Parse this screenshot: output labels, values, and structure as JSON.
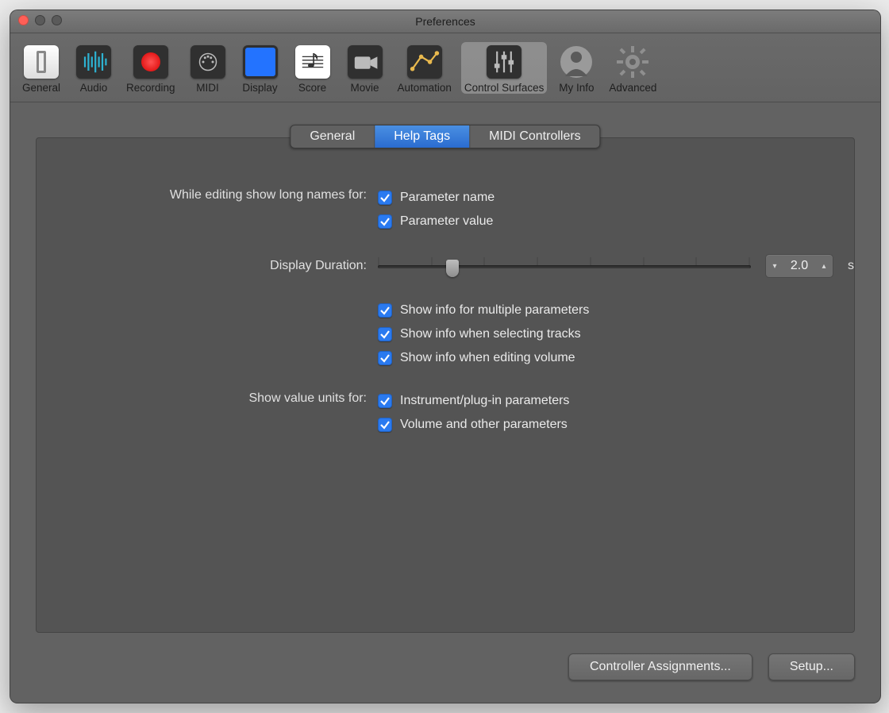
{
  "window_title": "Preferences",
  "toolbar": {
    "items": [
      {
        "id": "general",
        "label": "General"
      },
      {
        "id": "audio",
        "label": "Audio"
      },
      {
        "id": "recording",
        "label": "Recording"
      },
      {
        "id": "midi",
        "label": "MIDI"
      },
      {
        "id": "display",
        "label": "Display"
      },
      {
        "id": "score",
        "label": "Score"
      },
      {
        "id": "movie",
        "label": "Movie"
      },
      {
        "id": "automation",
        "label": "Automation"
      },
      {
        "id": "control-surfaces",
        "label": "Control Surfaces",
        "selected": true
      },
      {
        "id": "my-info",
        "label": "My Info"
      },
      {
        "id": "advanced",
        "label": "Advanced"
      }
    ]
  },
  "tabs": {
    "items": [
      {
        "label": "General"
      },
      {
        "label": "Help Tags",
        "active": true
      },
      {
        "label": "MIDI Controllers"
      }
    ]
  },
  "sections": {
    "long_names_label": "While editing show long names for:",
    "long_names": [
      {
        "label": "Parameter name",
        "checked": true
      },
      {
        "label": "Parameter value",
        "checked": true
      }
    ],
    "display_duration_label": "Display Duration:",
    "display_duration_value": "2.0",
    "display_duration_unit": "s",
    "extra_checks": [
      {
        "label": "Show info for multiple parameters",
        "checked": true
      },
      {
        "label": "Show info when selecting tracks",
        "checked": true
      },
      {
        "label": "Show info when editing volume",
        "checked": true
      }
    ],
    "value_units_label": "Show value units for:",
    "value_units": [
      {
        "label": "Instrument/plug-in parameters",
        "checked": true
      },
      {
        "label": "Volume and other parameters",
        "checked": true
      }
    ]
  },
  "buttons": {
    "controller_assignments": "Controller Assignments...",
    "setup": "Setup..."
  }
}
